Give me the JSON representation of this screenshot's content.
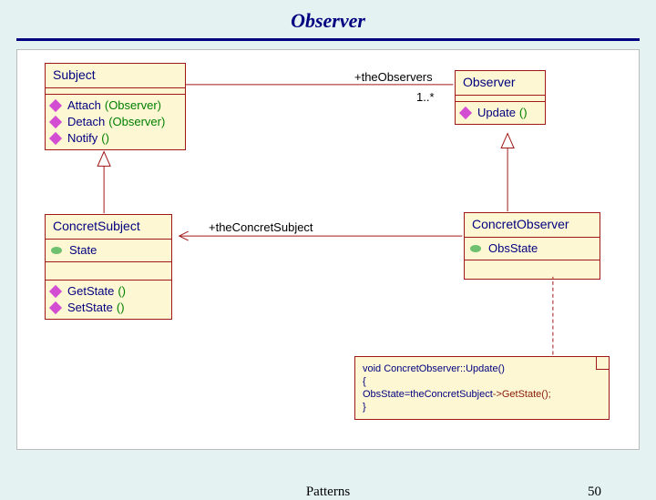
{
  "title": "Observer",
  "footer": {
    "center": "Patterns",
    "page": "50"
  },
  "subject": {
    "name": "Subject",
    "ops": [
      {
        "label": "Attach",
        "args": "(Observer)"
      },
      {
        "label": "Detach",
        "args": "(Observer)"
      },
      {
        "label": "Notify",
        "args": "()"
      }
    ]
  },
  "observer": {
    "name": "Observer",
    "ops": [
      {
        "label": "Update",
        "args": "()"
      }
    ]
  },
  "concret_subject": {
    "name": "ConcretSubject",
    "attrs": [
      "State"
    ],
    "ops": [
      {
        "label": "GetState",
        "args": "()"
      },
      {
        "label": "SetState",
        "args": "()"
      }
    ]
  },
  "concret_observer": {
    "name": "ConcretObserver",
    "attrs": [
      "ObsState"
    ]
  },
  "assoc1": {
    "role": "+theObservers",
    "mult": "1..*"
  },
  "assoc2": {
    "role": "+theConcretSubject"
  },
  "note": {
    "line1": "void ConcretObserver::Update()",
    "line2": "{",
    "line3a": "    ObsState=theConcretSubject",
    "line3b": "->GetState();",
    "line4": "}"
  }
}
